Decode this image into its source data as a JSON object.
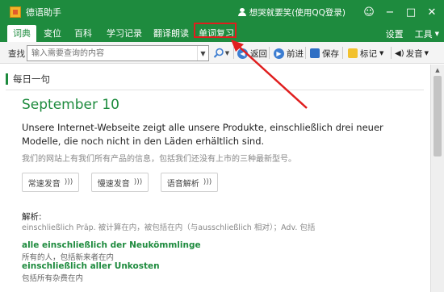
{
  "window": {
    "title": "德语助手",
    "user": "想哭就要笑(使用QQ登录)",
    "buttons": [
      "☺",
      "−",
      "□",
      "✕"
    ]
  },
  "menu": {
    "tabs": [
      "词典",
      "变位",
      "百科",
      "学习记录",
      "翻译朗读",
      "单词复习"
    ],
    "active_tab": "词典",
    "highlighted_tab": "单词复习",
    "right_items": [
      "设置",
      "工具"
    ]
  },
  "toolbar": {
    "search_label": "查找",
    "search_placeholder": "输入需要查询的内容",
    "back_label": "返回",
    "forward_label": "前进",
    "save_label": "保存",
    "bookmark_label": "标记",
    "pronounce_label": "发音"
  },
  "content": {
    "section_title": "每日一句",
    "date": "September 10",
    "german_sentence": "Unsere Internet-Webseite zeigt alle unsere Produkte, einschließlich drei neuer Modelle, die noch nicht in den Läden erhältlich sind.",
    "chinese_translation": "我们的网站上有我们所有产品的信息，包括我们还没有上市的三种最新型号。",
    "buttons": [
      "常速发音",
      "慢速发音",
      "语音解析"
    ],
    "analysis_label": "解析:",
    "analysis_text": "einschließlich Präp. 被计算在内，被包括在内（与ausschließlich 相对）；Adv. 包括",
    "examples": [
      {
        "de": "alle einschließlich der Neukömmlinge",
        "zh": "所有的人，包括新来者在内"
      },
      {
        "de": "einschließlich aller Unkosten",
        "zh": "包括所有杂费在内"
      }
    ]
  },
  "colors": {
    "brand_green": "#1e8b3e",
    "highlight_red": "#e01e1e"
  }
}
